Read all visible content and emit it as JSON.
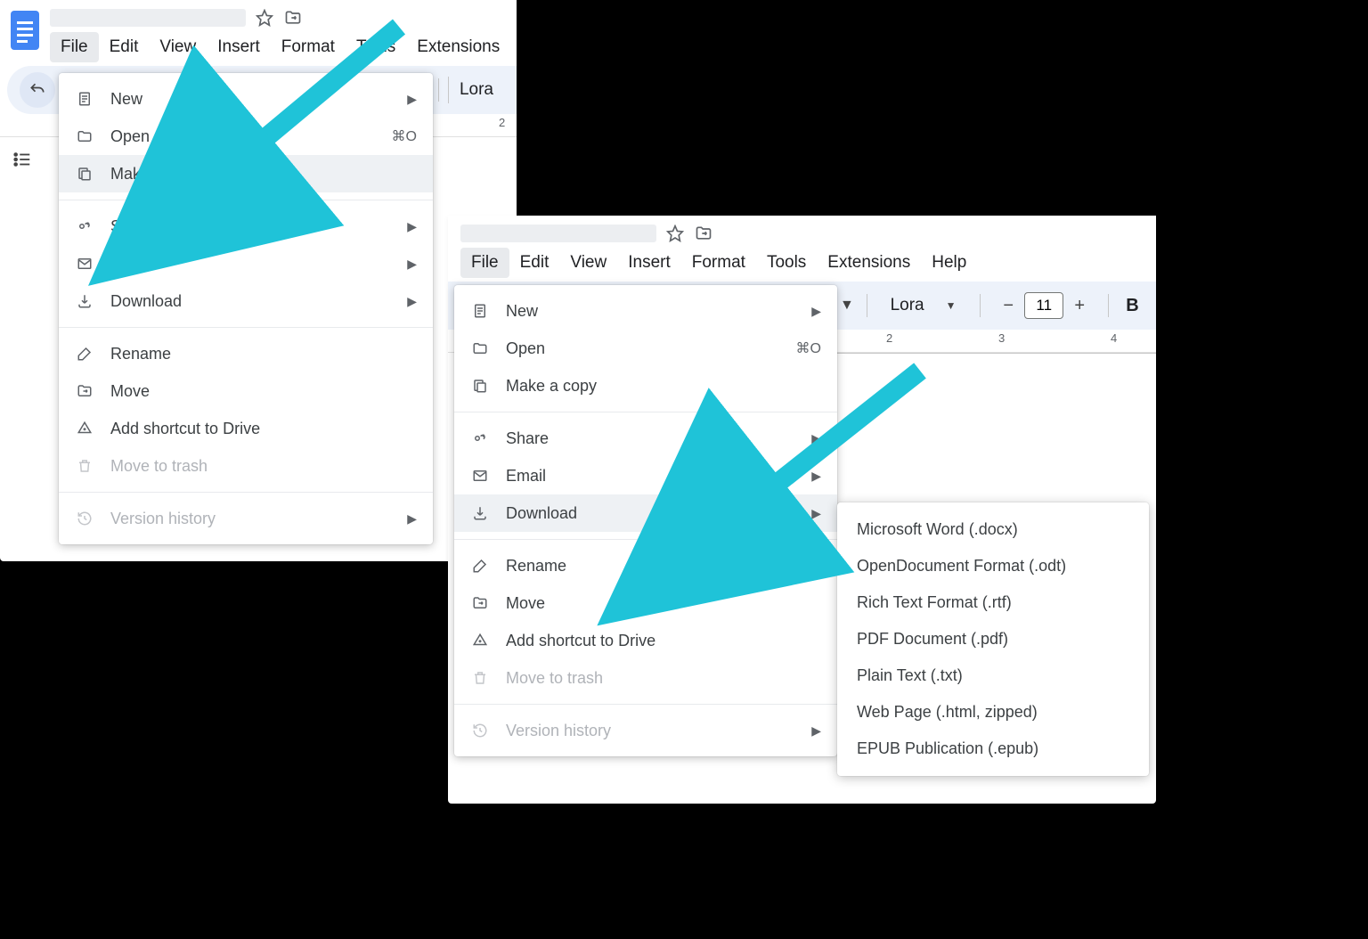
{
  "menubar": {
    "file": "File",
    "edit": "Edit",
    "view": "View",
    "insert": "Insert",
    "format": "Format",
    "tools": "Tools",
    "extensions": "Extensions",
    "help": "Help"
  },
  "toolbar": {
    "font": "Lora",
    "size": "11"
  },
  "ruler": {
    "n2": "2",
    "n3": "3",
    "n4": "4"
  },
  "menu": {
    "new": "New",
    "open": "Open",
    "open_accel": "⌘O",
    "copy": "Make a copy",
    "share": "Share",
    "email": "Email",
    "download": "Download",
    "rename": "Rename",
    "move": "Move",
    "shortcut": "Add shortcut to Drive",
    "trash": "Move to trash",
    "history": "Version history"
  },
  "download_sub": {
    "docx": "Microsoft Word (.docx)",
    "odt": "OpenDocument Format (.odt)",
    "rtf": "Rich Text Format (.rtf)",
    "pdf": "PDF Document (.pdf)",
    "txt": "Plain Text (.txt)",
    "html": "Web Page (.html, zipped)",
    "epub": "EPUB Publication (.epub)"
  }
}
